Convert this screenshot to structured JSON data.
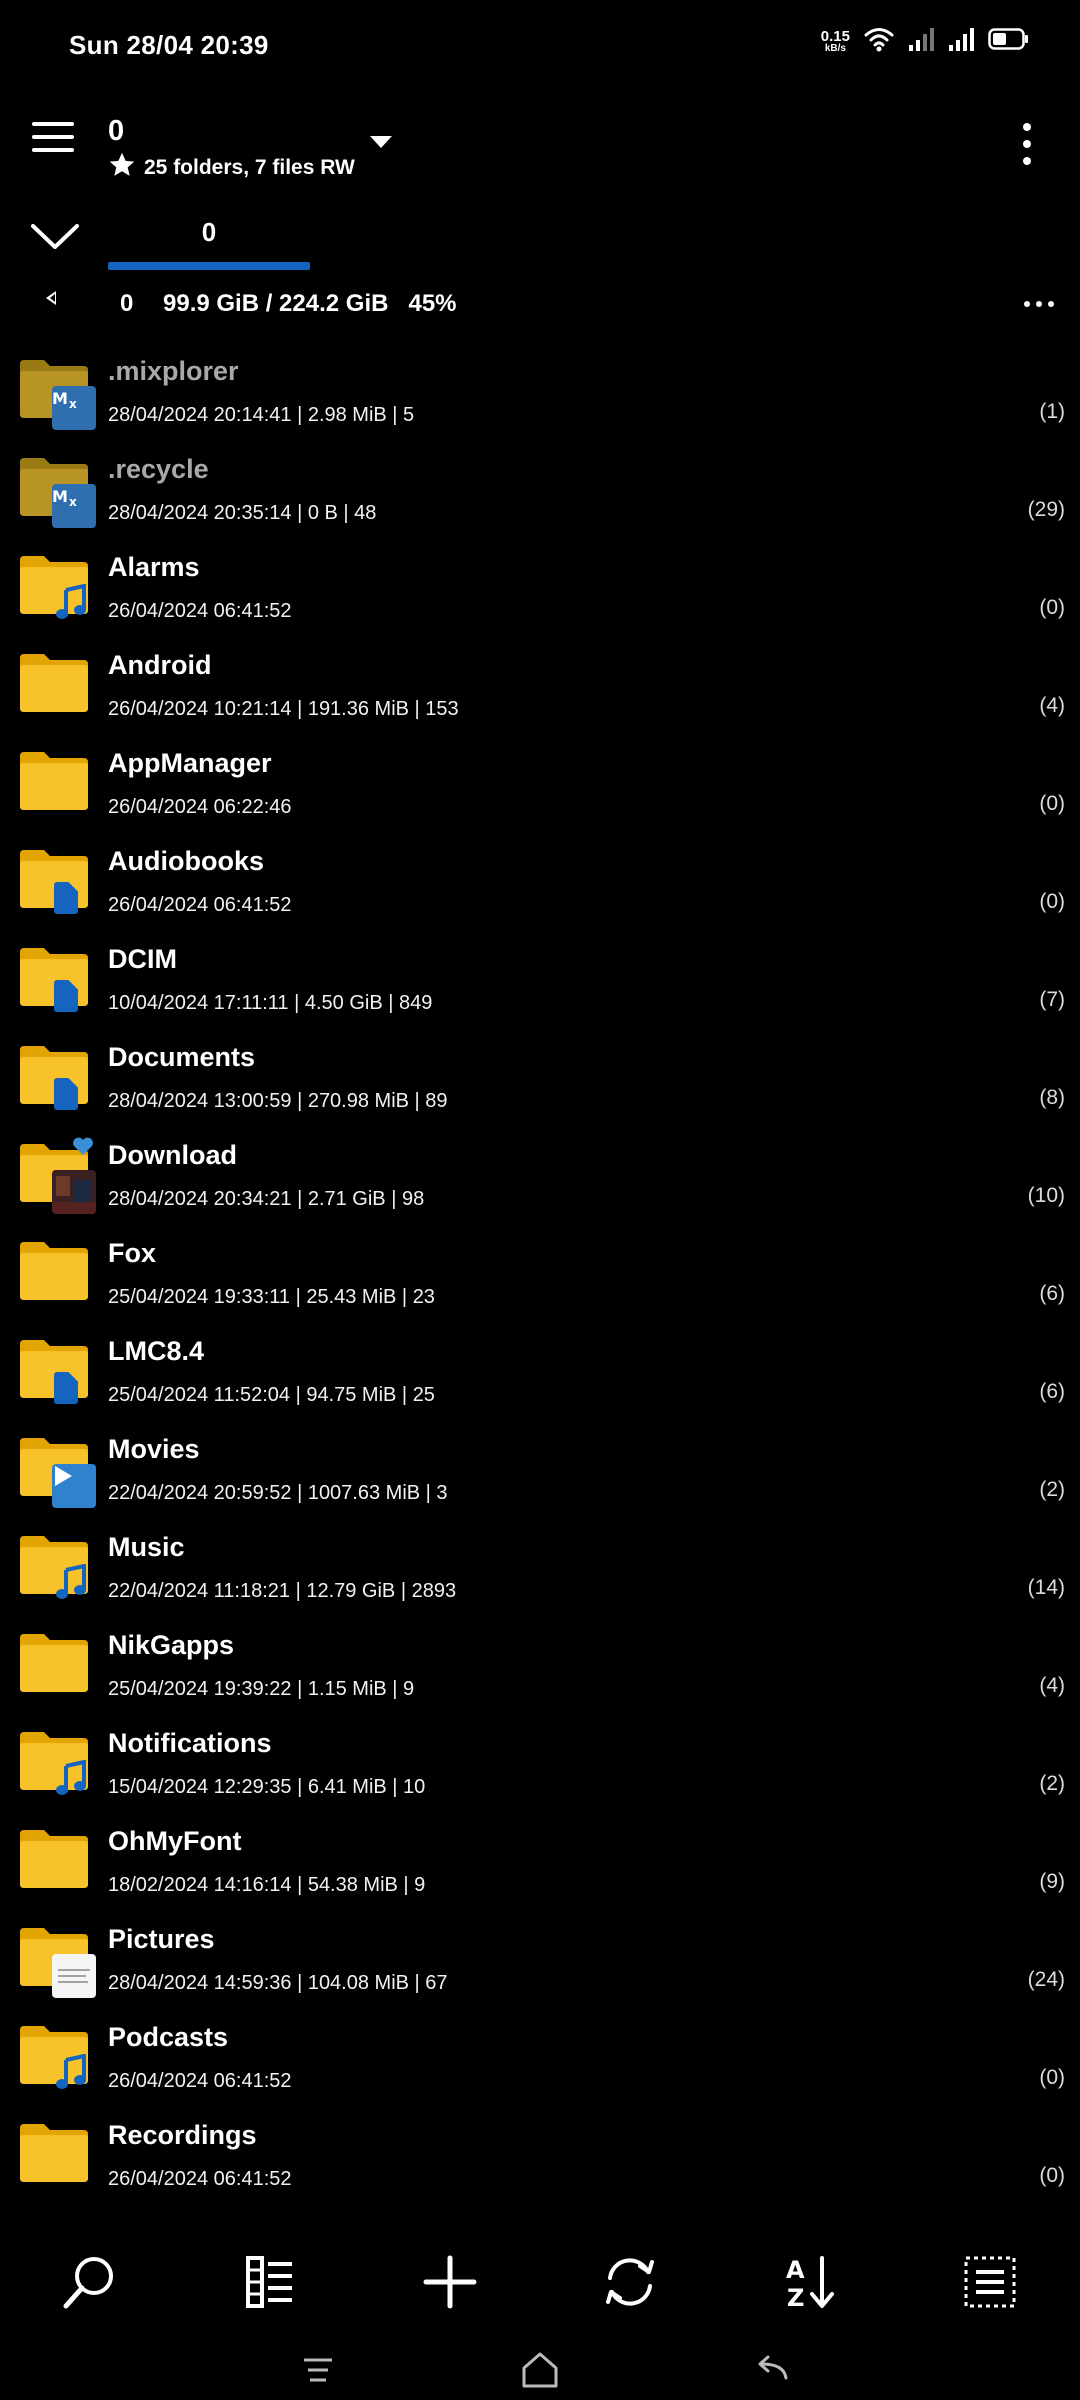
{
  "status_bar": {
    "time": "Sun 28/04 20:39",
    "net_speed_value": "0.15",
    "net_speed_unit": "kB/s",
    "icons": [
      "wifi-icon",
      "signal-icon",
      "signal-icon",
      "battery-icon"
    ],
    "battery_level": 0.45
  },
  "header": {
    "title": "0",
    "subtitle": "25 folders, 7 files RW"
  },
  "tabs": [
    {
      "label": "0"
    }
  ],
  "pathbar": {
    "root": "0",
    "storage": "99.9 GiB / 224.2 GiB",
    "storage_percent": "45%"
  },
  "colors": {
    "folder_front": "#f8c32a",
    "folder_back": "#e2a400",
    "folder_hidden_front": "#b79424",
    "folder_hidden_back": "#9a7a14",
    "tab_indicator": "#1565c0",
    "overlay_blue": "#1565c0"
  },
  "files": [
    {
      "name": ".mixplorer",
      "meta": "28/04/2024 20:14:41 | 2.98 MiB | 5",
      "count": "(1)",
      "hidden": true,
      "overlay": "mix"
    },
    {
      "name": ".recycle",
      "meta": "28/04/2024 20:35:14 | 0 B | 48",
      "count": "(29)",
      "hidden": true,
      "overlay": "mix"
    },
    {
      "name": "Alarms",
      "meta": "26/04/2024 06:41:52",
      "count": "(0)",
      "hidden": false,
      "overlay": "music"
    },
    {
      "name": "Android",
      "meta": "26/04/2024 10:21:14 | 191.36 MiB | 153",
      "count": "(4)",
      "hidden": false,
      "overlay": "none"
    },
    {
      "name": "AppManager",
      "meta": "26/04/2024 06:22:46",
      "count": "(0)",
      "hidden": false,
      "overlay": "none"
    },
    {
      "name": "Audiobooks",
      "meta": "26/04/2024 06:41:52",
      "count": "(0)",
      "hidden": false,
      "overlay": "doc"
    },
    {
      "name": "DCIM",
      "meta": "10/04/2024 17:11:11 | 4.50 GiB | 849",
      "count": "(7)",
      "hidden": false,
      "overlay": "doc"
    },
    {
      "name": "Documents",
      "meta": "28/04/2024 13:00:59 | 270.98 MiB | 89",
      "count": "(8)",
      "hidden": false,
      "overlay": "doc"
    },
    {
      "name": "Download",
      "meta": "28/04/2024 20:34:21 | 2.71 GiB | 98",
      "count": "(10)",
      "hidden": false,
      "overlay": "thumb",
      "favorite": true
    },
    {
      "name": "Fox",
      "meta": "25/04/2024 19:33:11 | 25.43 MiB | 23",
      "count": "(6)",
      "hidden": false,
      "overlay": "none"
    },
    {
      "name": "LMC8.4",
      "meta": "25/04/2024 11:52:04 | 94.75 MiB | 25",
      "count": "(6)",
      "hidden": false,
      "overlay": "doc"
    },
    {
      "name": "Movies",
      "meta": "22/04/2024 20:59:52 | 1007.63 MiB | 3",
      "count": "(2)",
      "hidden": false,
      "overlay": "play"
    },
    {
      "name": "Music",
      "meta": "22/04/2024 11:18:21 | 12.79 GiB | 2893",
      "count": "(14)",
      "hidden": false,
      "overlay": "music"
    },
    {
      "name": "NikGapps",
      "meta": "25/04/2024 19:39:22 | 1.15 MiB | 9",
      "count": "(4)",
      "hidden": false,
      "overlay": "none"
    },
    {
      "name": "Notifications",
      "meta": "15/04/2024 12:29:35 | 6.41 MiB | 10",
      "count": "(2)",
      "hidden": false,
      "overlay": "music"
    },
    {
      "name": "OhMyFont",
      "meta": "18/02/2024 14:16:14 | 54.38 MiB | 9",
      "count": "(9)",
      "hidden": false,
      "overlay": "none"
    },
    {
      "name": "Pictures",
      "meta": "28/04/2024 14:59:36 | 104.08 MiB | 67",
      "count": "(24)",
      "hidden": false,
      "overlay": "white"
    },
    {
      "name": "Podcasts",
      "meta": "26/04/2024 06:41:52",
      "count": "(0)",
      "hidden": false,
      "overlay": "music"
    },
    {
      "name": "Recordings",
      "meta": "26/04/2024 06:41:52",
      "count": "(0)",
      "hidden": false,
      "overlay": "none"
    }
  ],
  "toolbar": {
    "buttons": [
      "search-icon",
      "view-mode-icon",
      "add-icon",
      "refresh-icon",
      "sort-icon",
      "select-icon"
    ]
  },
  "navbar": {
    "buttons": [
      "recents-icon",
      "home-icon",
      "back-icon"
    ]
  }
}
